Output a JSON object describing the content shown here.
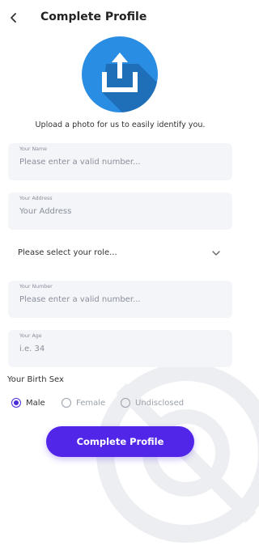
{
  "header": {
    "title": "Complete Profile",
    "back_icon": "chevron-left-icon"
  },
  "upload": {
    "icon": "upload-icon",
    "caption": "Upload a photo for us to easily identify you."
  },
  "fields": {
    "name": {
      "label": "Your Name",
      "placeholder": "Please enter a valid number..."
    },
    "address": {
      "label": "Your Address",
      "placeholder": "Your Address"
    },
    "role": {
      "selected": "Please select your role...",
      "icon": "chevron-down-icon"
    },
    "number": {
      "label": "Your Number",
      "placeholder": "Please enter a valid number..."
    },
    "age": {
      "label": "Your Age",
      "placeholder": "i.e. 34"
    }
  },
  "birth_sex": {
    "label": "Your Birth Sex",
    "options": [
      "Male",
      "Female",
      "Undisclosed"
    ],
    "selected": "Male"
  },
  "submit": {
    "label": "Complete Profile"
  },
  "colors": {
    "accent": "#5226e8",
    "upload_circle": "#2a8de4",
    "field_bg": "#f3f5f9"
  }
}
